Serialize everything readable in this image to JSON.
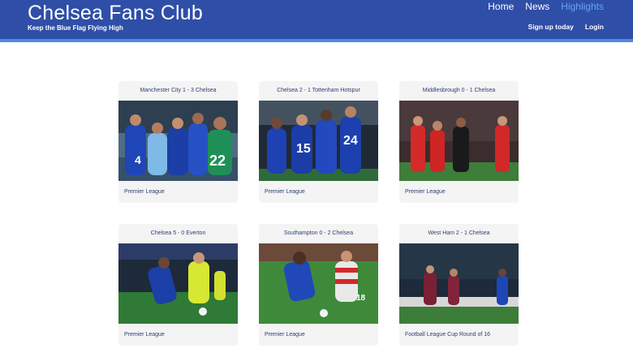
{
  "header": {
    "title": "Chelsea Fans Club",
    "tagline": "Keep the Blue Flag Flying High",
    "nav": [
      {
        "label": "Home",
        "active": false
      },
      {
        "label": "News",
        "active": false
      },
      {
        "label": "Highlights",
        "active": true
      }
    ],
    "actions": [
      {
        "label": "Sign up today"
      },
      {
        "label": "Login"
      }
    ],
    "colors": {
      "bar": "#2f4ea7",
      "accent": "#4a8be6",
      "active_link": "#5fa8f5"
    }
  },
  "highlights": [
    {
      "title": "Manchester City 1 - 3 Chelsea",
      "competition": "Premier League"
    },
    {
      "title": "Chelsea 2 - 1 Tottenham Hotspur",
      "competition": "Premier League"
    },
    {
      "title": "Middlesbrough 0 - 1 Chelsea",
      "competition": "Premier League"
    },
    {
      "title": "Chelsea 5 - 0 Everton",
      "competition": "Premier League"
    },
    {
      "title": "Southampton 0 - 2 Chelsea",
      "competition": "Premier League"
    },
    {
      "title": "West Ham 2 - 1 Chelsea",
      "competition": "Football League Cup Round of 16"
    }
  ]
}
